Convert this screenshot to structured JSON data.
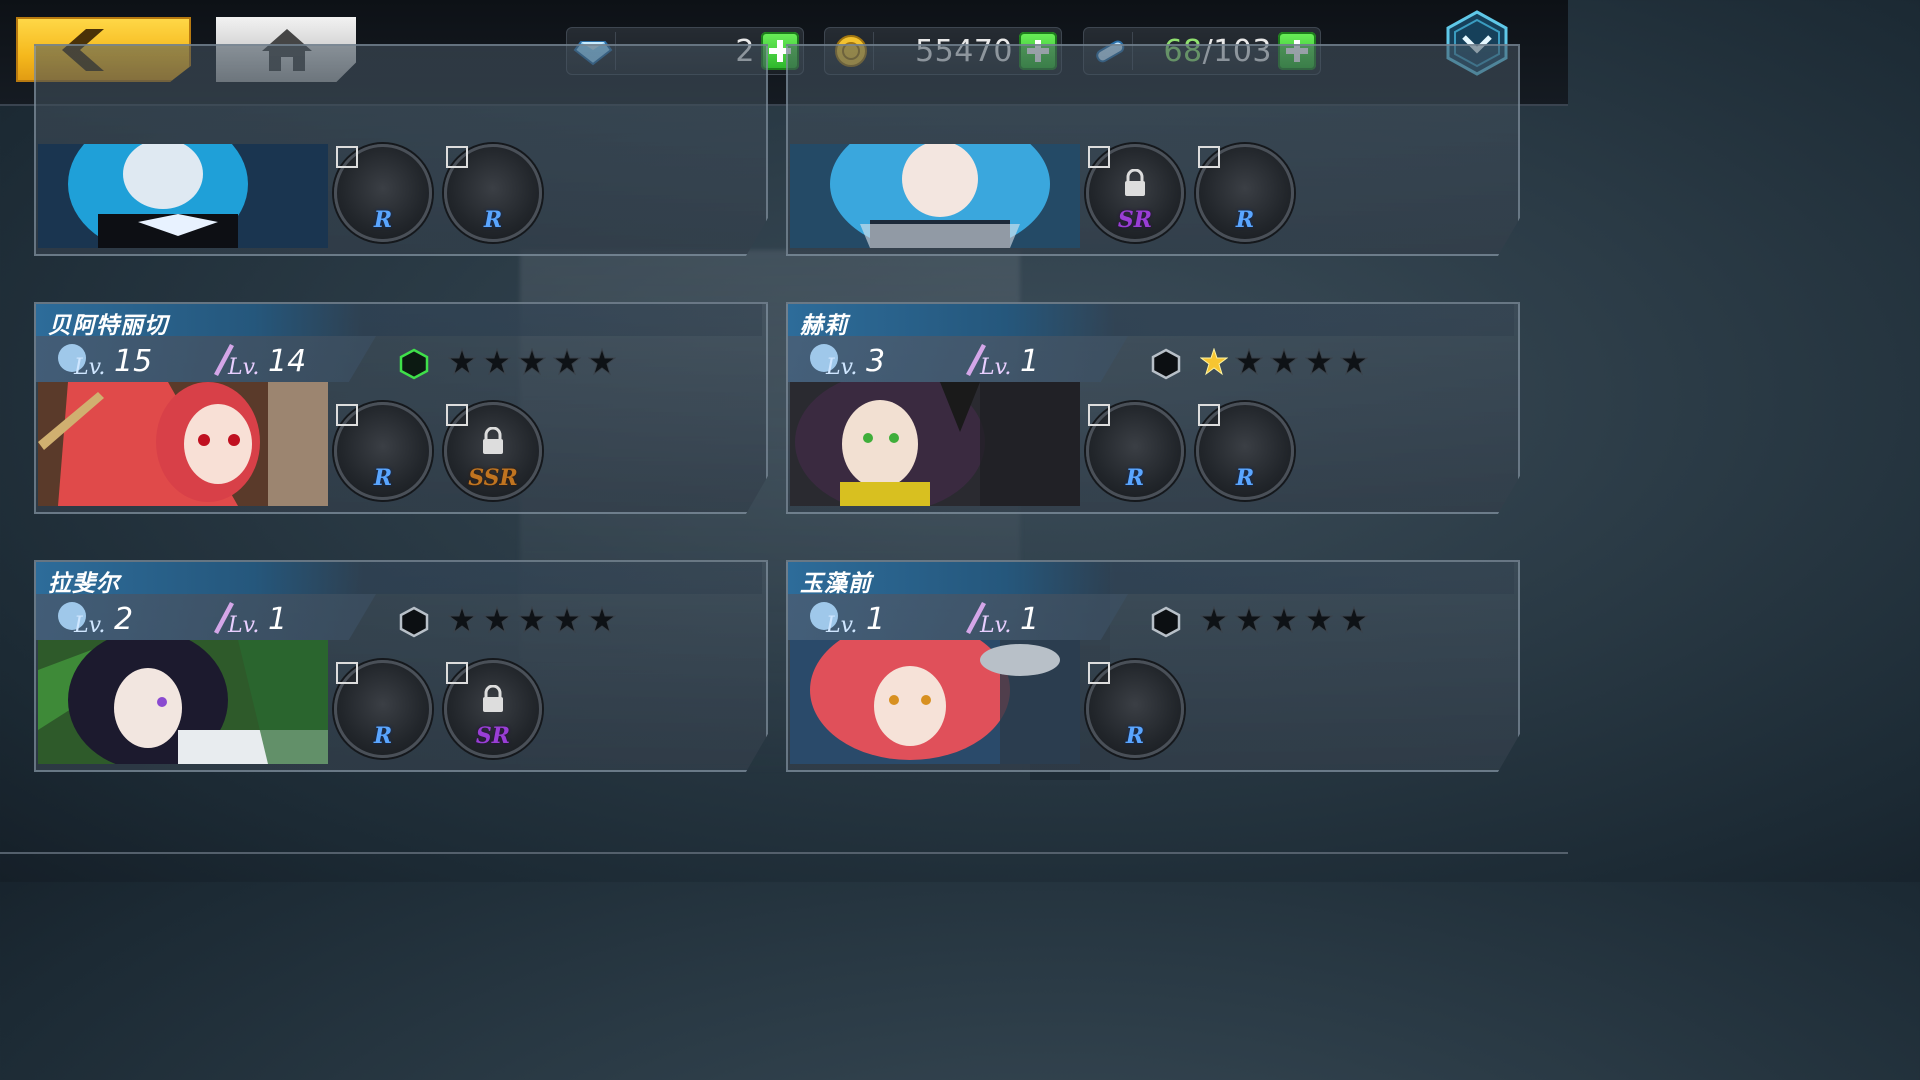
{
  "topbar": {
    "resources": [
      {
        "icon": "diamond-icon",
        "value": "2"
      },
      {
        "icon": "gold-coin-icon",
        "value": "55470"
      },
      {
        "icon": "stamina-capsule-icon",
        "value_current": "68",
        "value_max": "/103"
      }
    ]
  },
  "characters": [
    {
      "slot": "top-left",
      "name": "",
      "equipment": [
        {
          "rarity": "R",
          "locked": false
        },
        {
          "rarity": "R",
          "locked": false
        }
      ]
    },
    {
      "slot": "top-right",
      "name": "",
      "equipment": [
        {
          "rarity": "SR",
          "locked": true
        },
        {
          "rarity": "R",
          "locked": false
        }
      ]
    },
    {
      "slot": "mid-left",
      "name": "贝阿特丽切",
      "level_a": "15",
      "level_b": "14",
      "stars": 0,
      "hex_active": true,
      "equipment": [
        {
          "rarity": "R",
          "locked": false
        },
        {
          "rarity": "SSR",
          "locked": true
        }
      ]
    },
    {
      "slot": "mid-right",
      "name": "赫莉",
      "level_a": "3",
      "level_b": "1",
      "stars": 1,
      "hex_active": false,
      "equipment": [
        {
          "rarity": "R",
          "locked": false
        },
        {
          "rarity": "R",
          "locked": false
        }
      ]
    },
    {
      "slot": "bottom-left",
      "name": "拉斐尔",
      "level_a": "2",
      "level_b": "1",
      "stars": 0,
      "hex_active": false,
      "equipment": [
        {
          "rarity": "R",
          "locked": false
        },
        {
          "rarity": "SR",
          "locked": true
        }
      ]
    },
    {
      "slot": "bottom-right",
      "name": "玉藻前",
      "level_a": "1",
      "level_b": "1",
      "stars": 0,
      "hex_active": false,
      "equipment": [
        {
          "rarity": "R",
          "locked": false
        }
      ]
    }
  ],
  "labels": {
    "lv": "Lv."
  },
  "colors": {
    "accent_gold": "#f5b81c",
    "plus_green": "#2bb52a",
    "rarity_R": "#5aa6ff",
    "rarity_SR": "#9a3ed6",
    "rarity_SSR": "#c07420",
    "star_active": "#f7c531"
  }
}
